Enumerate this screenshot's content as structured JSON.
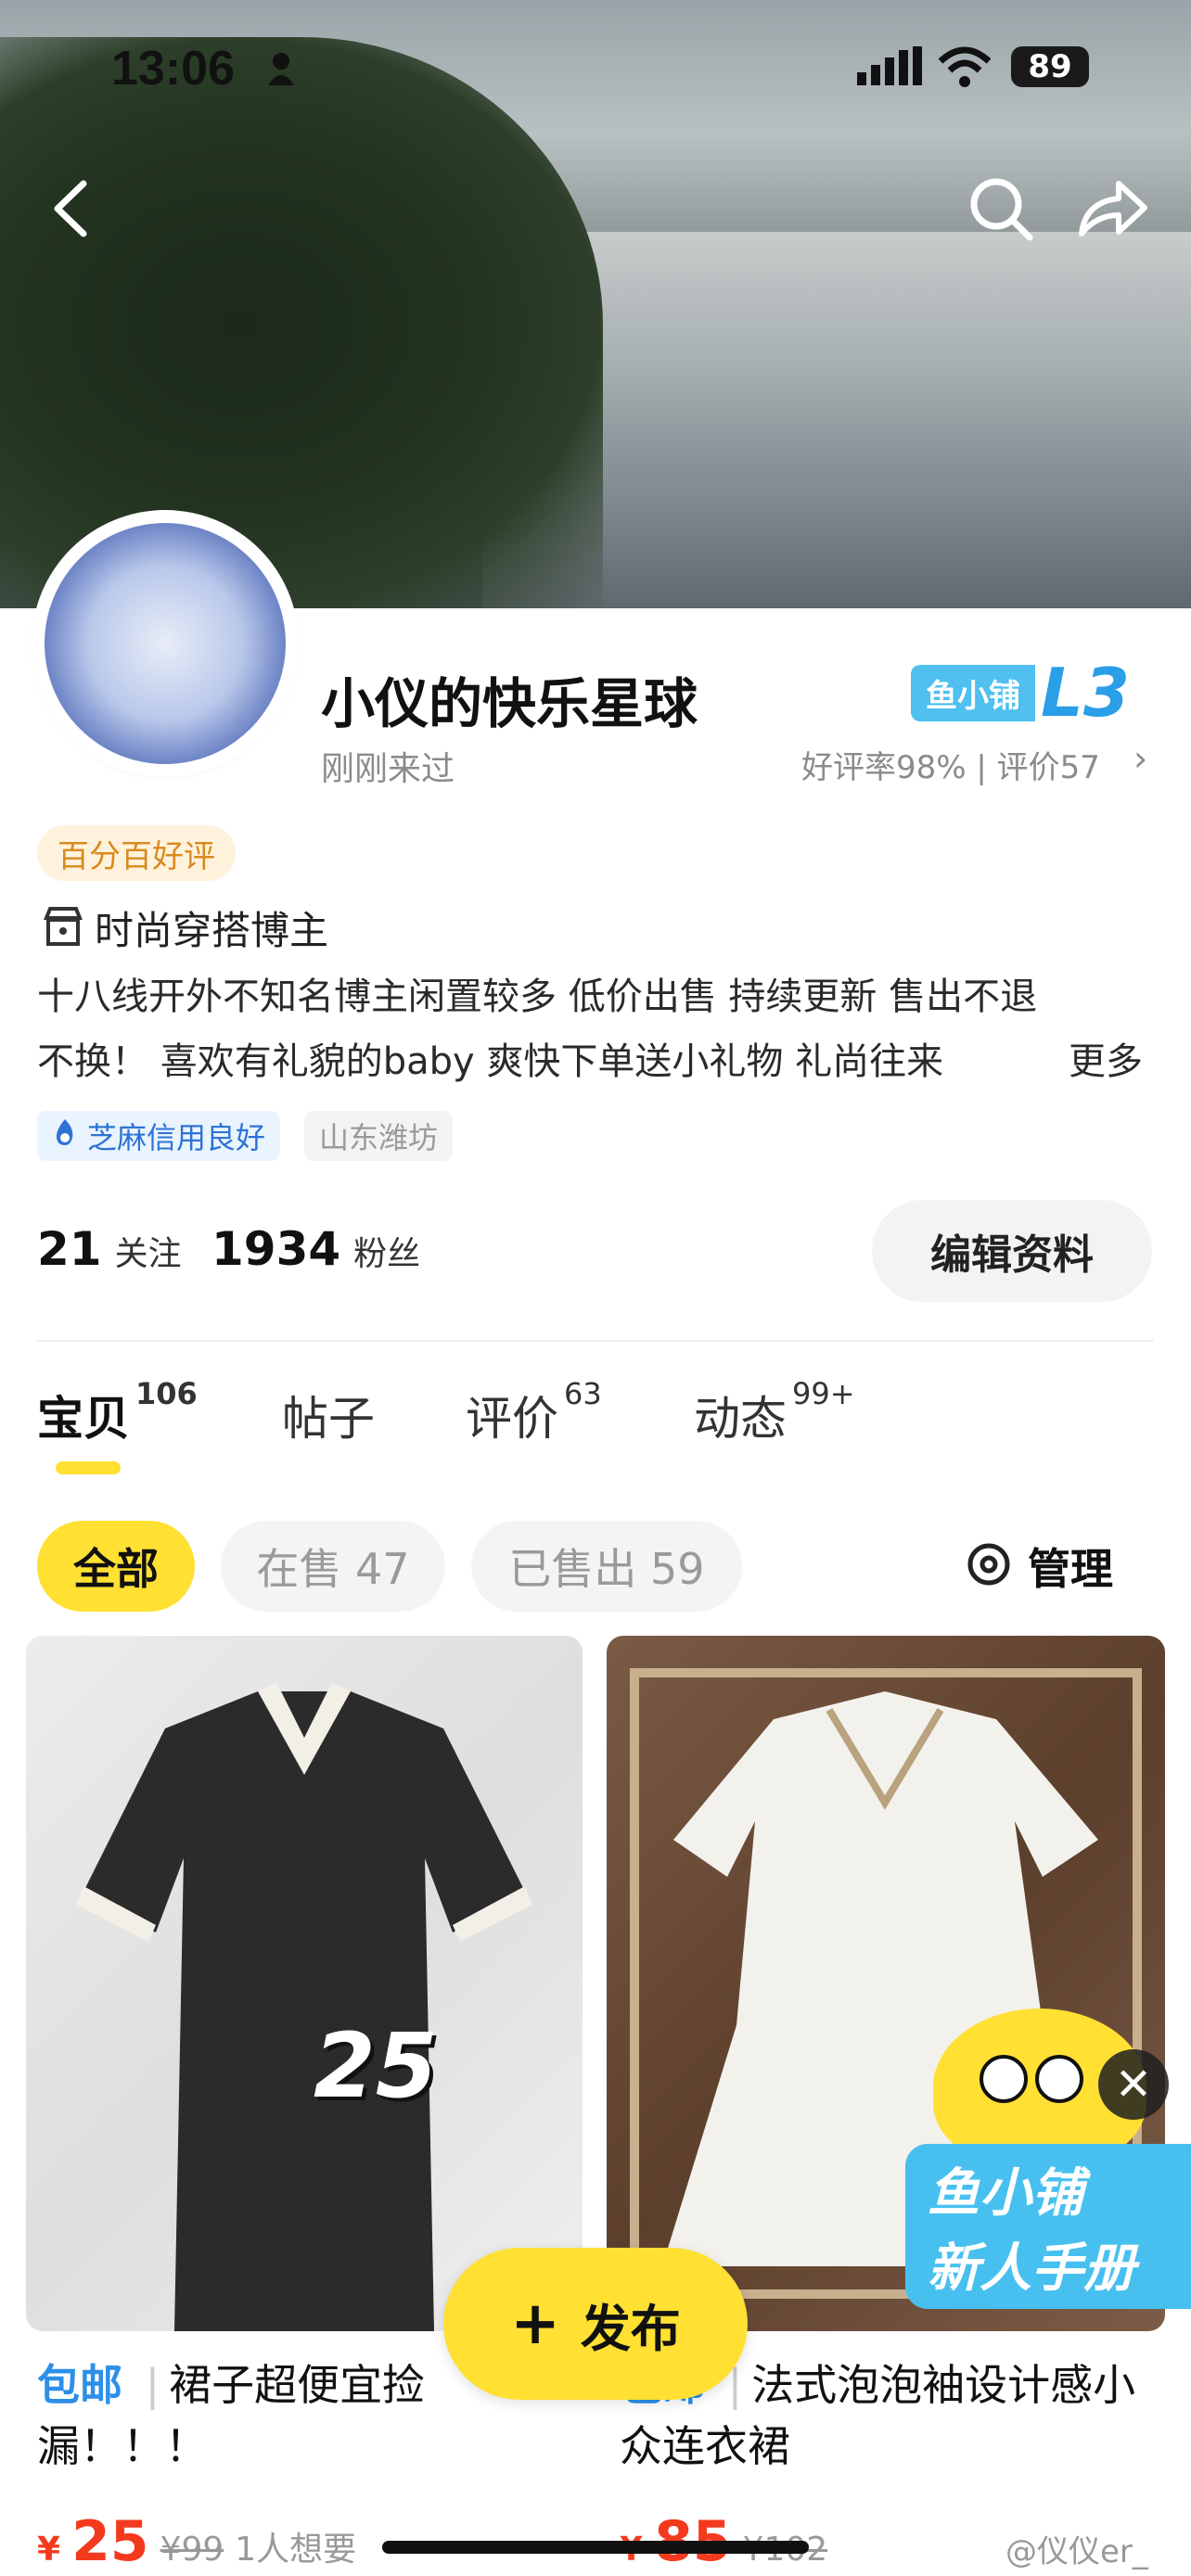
{
  "status": {
    "time": "13:06",
    "battery": "89"
  },
  "profile": {
    "name": "小仪的快乐星球",
    "last_seen": "刚刚来过",
    "shop_badge": "鱼小铺",
    "level": "L3",
    "rating_text": "好评率98% | 评价57",
    "good_review_tag": "百分百好评",
    "category": "时尚穿搭博主",
    "bio_line1": "十八线开外不知名博主闲置较多 低价出售 持续更新 售出不退",
    "bio_line2": "不换！ 喜欢有礼貌的baby 爽快下单送小礼物 礼尚往来",
    "bio_more": "更多",
    "credit_chip": "芝麻信用良好",
    "location_chip": "山东潍坊"
  },
  "stats": {
    "following_count": "21",
    "following_label": "关注",
    "followers_count": "1934",
    "followers_label": "粉丝",
    "edit_label": "编辑资料"
  },
  "tabs": [
    {
      "label": "宝贝",
      "count": "106"
    },
    {
      "label": "帖子",
      "count": ""
    },
    {
      "label": "评价",
      "count": "63"
    },
    {
      "label": "动态",
      "count": "99+"
    }
  ],
  "filters": {
    "all": "全部",
    "on_sale": "在售 47",
    "sold": "已售出 59",
    "manage": "管理"
  },
  "items": [
    {
      "shipping": "包邮",
      "title_line1": "裙子超便宜捡",
      "title_line2": "漏！！！",
      "image_overlay": "25",
      "price_symbol": "¥",
      "price": "25",
      "orig_price": "¥99",
      "wants": "1人想要"
    },
    {
      "shipping": "包邮",
      "title_line1": "法式泡泡袖设计感小",
      "title_line2": "众连衣裙",
      "price_symbol": "¥",
      "price": "85",
      "orig_price": "¥102"
    }
  ],
  "publish_label": "发布",
  "promo": {
    "line1": "鱼小铺",
    "line2": "新人手册"
  },
  "watermark": "@仪仪er_",
  "colors": {
    "accent_yellow": "#ffe033",
    "price_red": "#f43a1e",
    "badge_blue": "#4fc0ef"
  }
}
